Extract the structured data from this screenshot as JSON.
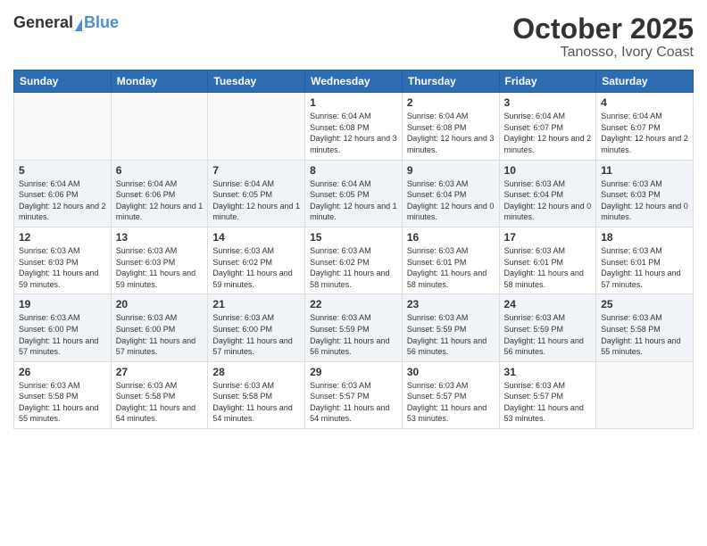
{
  "header": {
    "logo_general": "General",
    "logo_blue": "Blue",
    "month": "October 2025",
    "location": "Tanosso, Ivory Coast"
  },
  "weekdays": [
    "Sunday",
    "Monday",
    "Tuesday",
    "Wednesday",
    "Thursday",
    "Friday",
    "Saturday"
  ],
  "weeks": [
    [
      {
        "day": "",
        "info": ""
      },
      {
        "day": "",
        "info": ""
      },
      {
        "day": "",
        "info": ""
      },
      {
        "day": "1",
        "info": "Sunrise: 6:04 AM\nSunset: 6:08 PM\nDaylight: 12 hours and 3 minutes."
      },
      {
        "day": "2",
        "info": "Sunrise: 6:04 AM\nSunset: 6:08 PM\nDaylight: 12 hours and 3 minutes."
      },
      {
        "day": "3",
        "info": "Sunrise: 6:04 AM\nSunset: 6:07 PM\nDaylight: 12 hours and 2 minutes."
      },
      {
        "day": "4",
        "info": "Sunrise: 6:04 AM\nSunset: 6:07 PM\nDaylight: 12 hours and 2 minutes."
      }
    ],
    [
      {
        "day": "5",
        "info": "Sunrise: 6:04 AM\nSunset: 6:06 PM\nDaylight: 12 hours and 2 minutes."
      },
      {
        "day": "6",
        "info": "Sunrise: 6:04 AM\nSunset: 6:06 PM\nDaylight: 12 hours and 1 minute."
      },
      {
        "day": "7",
        "info": "Sunrise: 6:04 AM\nSunset: 6:05 PM\nDaylight: 12 hours and 1 minute."
      },
      {
        "day": "8",
        "info": "Sunrise: 6:04 AM\nSunset: 6:05 PM\nDaylight: 12 hours and 1 minute."
      },
      {
        "day": "9",
        "info": "Sunrise: 6:03 AM\nSunset: 6:04 PM\nDaylight: 12 hours and 0 minutes."
      },
      {
        "day": "10",
        "info": "Sunrise: 6:03 AM\nSunset: 6:04 PM\nDaylight: 12 hours and 0 minutes."
      },
      {
        "day": "11",
        "info": "Sunrise: 6:03 AM\nSunset: 6:03 PM\nDaylight: 12 hours and 0 minutes."
      }
    ],
    [
      {
        "day": "12",
        "info": "Sunrise: 6:03 AM\nSunset: 6:03 PM\nDaylight: 11 hours and 59 minutes."
      },
      {
        "day": "13",
        "info": "Sunrise: 6:03 AM\nSunset: 6:03 PM\nDaylight: 11 hours and 59 minutes."
      },
      {
        "day": "14",
        "info": "Sunrise: 6:03 AM\nSunset: 6:02 PM\nDaylight: 11 hours and 59 minutes."
      },
      {
        "day": "15",
        "info": "Sunrise: 6:03 AM\nSunset: 6:02 PM\nDaylight: 11 hours and 58 minutes."
      },
      {
        "day": "16",
        "info": "Sunrise: 6:03 AM\nSunset: 6:01 PM\nDaylight: 11 hours and 58 minutes."
      },
      {
        "day": "17",
        "info": "Sunrise: 6:03 AM\nSunset: 6:01 PM\nDaylight: 11 hours and 58 minutes."
      },
      {
        "day": "18",
        "info": "Sunrise: 6:03 AM\nSunset: 6:01 PM\nDaylight: 11 hours and 57 minutes."
      }
    ],
    [
      {
        "day": "19",
        "info": "Sunrise: 6:03 AM\nSunset: 6:00 PM\nDaylight: 11 hours and 57 minutes."
      },
      {
        "day": "20",
        "info": "Sunrise: 6:03 AM\nSunset: 6:00 PM\nDaylight: 11 hours and 57 minutes."
      },
      {
        "day": "21",
        "info": "Sunrise: 6:03 AM\nSunset: 6:00 PM\nDaylight: 11 hours and 57 minutes."
      },
      {
        "day": "22",
        "info": "Sunrise: 6:03 AM\nSunset: 5:59 PM\nDaylight: 11 hours and 56 minutes."
      },
      {
        "day": "23",
        "info": "Sunrise: 6:03 AM\nSunset: 5:59 PM\nDaylight: 11 hours and 56 minutes."
      },
      {
        "day": "24",
        "info": "Sunrise: 6:03 AM\nSunset: 5:59 PM\nDaylight: 11 hours and 56 minutes."
      },
      {
        "day": "25",
        "info": "Sunrise: 6:03 AM\nSunset: 5:58 PM\nDaylight: 11 hours and 55 minutes."
      }
    ],
    [
      {
        "day": "26",
        "info": "Sunrise: 6:03 AM\nSunset: 5:58 PM\nDaylight: 11 hours and 55 minutes."
      },
      {
        "day": "27",
        "info": "Sunrise: 6:03 AM\nSunset: 5:58 PM\nDaylight: 11 hours and 54 minutes."
      },
      {
        "day": "28",
        "info": "Sunrise: 6:03 AM\nSunset: 5:58 PM\nDaylight: 11 hours and 54 minutes."
      },
      {
        "day": "29",
        "info": "Sunrise: 6:03 AM\nSunset: 5:57 PM\nDaylight: 11 hours and 54 minutes."
      },
      {
        "day": "30",
        "info": "Sunrise: 6:03 AM\nSunset: 5:57 PM\nDaylight: 11 hours and 53 minutes."
      },
      {
        "day": "31",
        "info": "Sunrise: 6:03 AM\nSunset: 5:57 PM\nDaylight: 11 hours and 53 minutes."
      },
      {
        "day": "",
        "info": ""
      }
    ]
  ]
}
